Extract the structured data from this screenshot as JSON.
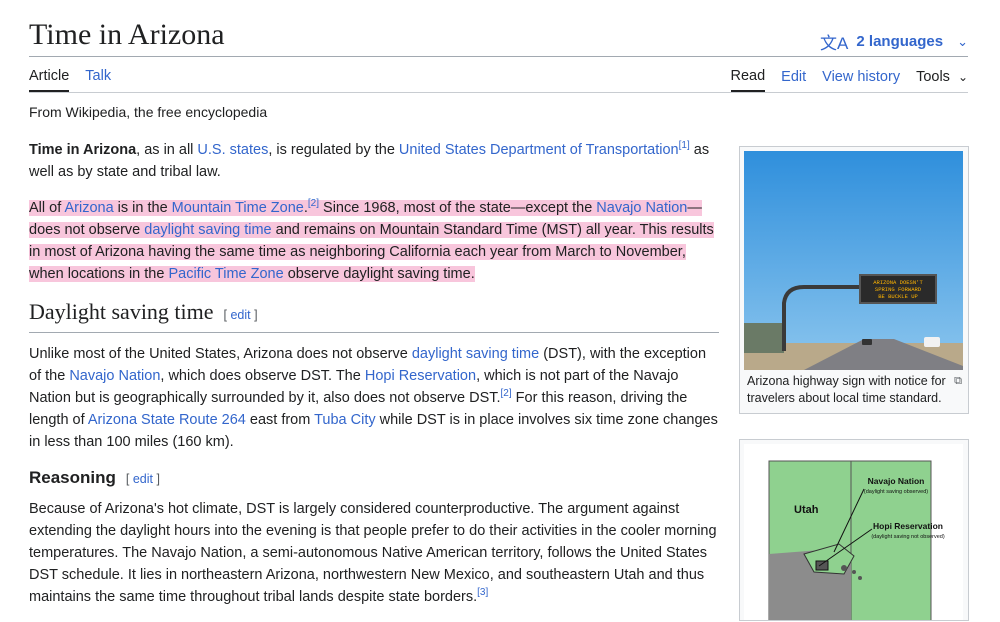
{
  "header": {
    "title": "Time in Arizona",
    "languages_label": "2 languages"
  },
  "tabs": {
    "article": "Article",
    "talk": "Talk",
    "read": "Read",
    "edit": "Edit",
    "history": "View history",
    "tools": "Tools"
  },
  "tagline": "From Wikipedia, the free encyclopedia",
  "intro": {
    "p1_bold": "Time in Arizona",
    "p1_a": ", as in all ",
    "p1_link1": "U.S. states",
    "p1_b": ", is regulated by the ",
    "p1_link2": "United States Department of Transportation",
    "p1_ref": "[1]",
    "p1_c": " as well as by state and tribal law.",
    "p2_a": "All of ",
    "p2_link1": "Arizona",
    "p2_b": " is in the ",
    "p2_link2": "Mountain Time Zone",
    "p2_ref": "[2]",
    "p2_c": " Since 1968, most of the state—except the ",
    "p2_link3": "Navajo Nation",
    "p2_d": "—does not observe ",
    "p2_link4": "daylight saving time",
    "p2_e": " and remains on Mountain Standard Time (MST) all year. This results in most of Arizona having the same time as neighboring California each year from March to November, when locations in the ",
    "p2_link5": "Pacific Time Zone",
    "p2_f": " observe daylight saving time."
  },
  "section_dst": {
    "heading": "Daylight saving time",
    "edit_label": "edit",
    "p_a": "Unlike most of the United States, Arizona does not observe ",
    "p_link1": "daylight saving time",
    "p_b": " (DST), with the exception of the ",
    "p_link2": "Navajo Nation",
    "p_c": ", which does observe DST. The ",
    "p_link3": "Hopi Reservation",
    "p_d": ", which is not part of the Navajo Nation but is geographically surrounded by it, also does not observe DST.",
    "p_ref": "[2]",
    "p_e": " For this reason, driving the length of ",
    "p_link4": "Arizona State Route 264",
    "p_f": " east from ",
    "p_link5": "Tuba City",
    "p_g": " while DST is in place involves six time zone changes in less than 100 miles (160 km)."
  },
  "section_reasoning": {
    "heading": "Reasoning",
    "edit_label": "edit",
    "p": "Because of Arizona's hot climate, DST is largely considered counterproductive. The argument against extending the daylight hours into the evening is that people prefer to do their activities in the cooler morning temperatures. The Navajo Nation, a semi-autonomous Native American territory, follows the United States DST schedule. It lies in northeastern Arizona, northwestern New Mexico, and southeastern Utah and thus maintains the same time throughout tribal lands despite state borders.",
    "ref": "[3]"
  },
  "figure1": {
    "sign_line1": "ARIZONA DOESN'T",
    "sign_line2": "SPRING FORWARD",
    "sign_line3": "BE BUCKLE UP",
    "caption": "Arizona highway sign with notice for travelers about local time standard."
  },
  "figure2": {
    "label_utah": "Utah",
    "label_navajo": "Navajo Nation",
    "label_navajo_note": "(daylight saving observed)",
    "label_hopi": "Hopi Reservation",
    "label_hopi_note": "(daylight saving not observed)"
  },
  "colors": {
    "link": "#3366cc",
    "highlight": "#f8c6dc",
    "map_green": "#8fd18f",
    "map_gray": "#8c8c8c"
  }
}
